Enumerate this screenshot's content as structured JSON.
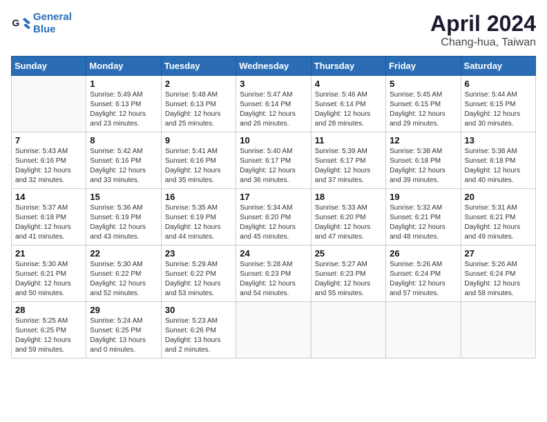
{
  "logo": {
    "line1": "General",
    "line2": "Blue"
  },
  "title": "April 2024",
  "subtitle": "Chang-hua, Taiwan",
  "weekdays": [
    "Sunday",
    "Monday",
    "Tuesday",
    "Wednesday",
    "Thursday",
    "Friday",
    "Saturday"
  ],
  "weeks": [
    [
      {
        "day": "",
        "info": ""
      },
      {
        "day": "1",
        "info": "Sunrise: 5:49 AM\nSunset: 6:13 PM\nDaylight: 12 hours\nand 23 minutes."
      },
      {
        "day": "2",
        "info": "Sunrise: 5:48 AM\nSunset: 6:13 PM\nDaylight: 12 hours\nand 25 minutes."
      },
      {
        "day": "3",
        "info": "Sunrise: 5:47 AM\nSunset: 6:14 PM\nDaylight: 12 hours\nand 26 minutes."
      },
      {
        "day": "4",
        "info": "Sunrise: 5:46 AM\nSunset: 6:14 PM\nDaylight: 12 hours\nand 28 minutes."
      },
      {
        "day": "5",
        "info": "Sunrise: 5:45 AM\nSunset: 6:15 PM\nDaylight: 12 hours\nand 29 minutes."
      },
      {
        "day": "6",
        "info": "Sunrise: 5:44 AM\nSunset: 6:15 PM\nDaylight: 12 hours\nand 30 minutes."
      }
    ],
    [
      {
        "day": "7",
        "info": "Sunrise: 5:43 AM\nSunset: 6:16 PM\nDaylight: 12 hours\nand 32 minutes."
      },
      {
        "day": "8",
        "info": "Sunrise: 5:42 AM\nSunset: 6:16 PM\nDaylight: 12 hours\nand 33 minutes."
      },
      {
        "day": "9",
        "info": "Sunrise: 5:41 AM\nSunset: 6:16 PM\nDaylight: 12 hours\nand 35 minutes."
      },
      {
        "day": "10",
        "info": "Sunrise: 5:40 AM\nSunset: 6:17 PM\nDaylight: 12 hours\nand 36 minutes."
      },
      {
        "day": "11",
        "info": "Sunrise: 5:39 AM\nSunset: 6:17 PM\nDaylight: 12 hours\nand 37 minutes."
      },
      {
        "day": "12",
        "info": "Sunrise: 5:38 AM\nSunset: 6:18 PM\nDaylight: 12 hours\nand 39 minutes."
      },
      {
        "day": "13",
        "info": "Sunrise: 5:38 AM\nSunset: 6:18 PM\nDaylight: 12 hours\nand 40 minutes."
      }
    ],
    [
      {
        "day": "14",
        "info": "Sunrise: 5:37 AM\nSunset: 6:18 PM\nDaylight: 12 hours\nand 41 minutes."
      },
      {
        "day": "15",
        "info": "Sunrise: 5:36 AM\nSunset: 6:19 PM\nDaylight: 12 hours\nand 43 minutes."
      },
      {
        "day": "16",
        "info": "Sunrise: 5:35 AM\nSunset: 6:19 PM\nDaylight: 12 hours\nand 44 minutes."
      },
      {
        "day": "17",
        "info": "Sunrise: 5:34 AM\nSunset: 6:20 PM\nDaylight: 12 hours\nand 45 minutes."
      },
      {
        "day": "18",
        "info": "Sunrise: 5:33 AM\nSunset: 6:20 PM\nDaylight: 12 hours\nand 47 minutes."
      },
      {
        "day": "19",
        "info": "Sunrise: 5:32 AM\nSunset: 6:21 PM\nDaylight: 12 hours\nand 48 minutes."
      },
      {
        "day": "20",
        "info": "Sunrise: 5:31 AM\nSunset: 6:21 PM\nDaylight: 12 hours\nand 49 minutes."
      }
    ],
    [
      {
        "day": "21",
        "info": "Sunrise: 5:30 AM\nSunset: 6:21 PM\nDaylight: 12 hours\nand 50 minutes."
      },
      {
        "day": "22",
        "info": "Sunrise: 5:30 AM\nSunset: 6:22 PM\nDaylight: 12 hours\nand 52 minutes."
      },
      {
        "day": "23",
        "info": "Sunrise: 5:29 AM\nSunset: 6:22 PM\nDaylight: 12 hours\nand 53 minutes."
      },
      {
        "day": "24",
        "info": "Sunrise: 5:28 AM\nSunset: 6:23 PM\nDaylight: 12 hours\nand 54 minutes."
      },
      {
        "day": "25",
        "info": "Sunrise: 5:27 AM\nSunset: 6:23 PM\nDaylight: 12 hours\nand 55 minutes."
      },
      {
        "day": "26",
        "info": "Sunrise: 5:26 AM\nSunset: 6:24 PM\nDaylight: 12 hours\nand 57 minutes."
      },
      {
        "day": "27",
        "info": "Sunrise: 5:26 AM\nSunset: 6:24 PM\nDaylight: 12 hours\nand 58 minutes."
      }
    ],
    [
      {
        "day": "28",
        "info": "Sunrise: 5:25 AM\nSunset: 6:25 PM\nDaylight: 12 hours\nand 59 minutes."
      },
      {
        "day": "29",
        "info": "Sunrise: 5:24 AM\nSunset: 6:25 PM\nDaylight: 13 hours\nand 0 minutes."
      },
      {
        "day": "30",
        "info": "Sunrise: 5:23 AM\nSunset: 6:26 PM\nDaylight: 13 hours\nand 2 minutes."
      },
      {
        "day": "",
        "info": ""
      },
      {
        "day": "",
        "info": ""
      },
      {
        "day": "",
        "info": ""
      },
      {
        "day": "",
        "info": ""
      }
    ]
  ]
}
